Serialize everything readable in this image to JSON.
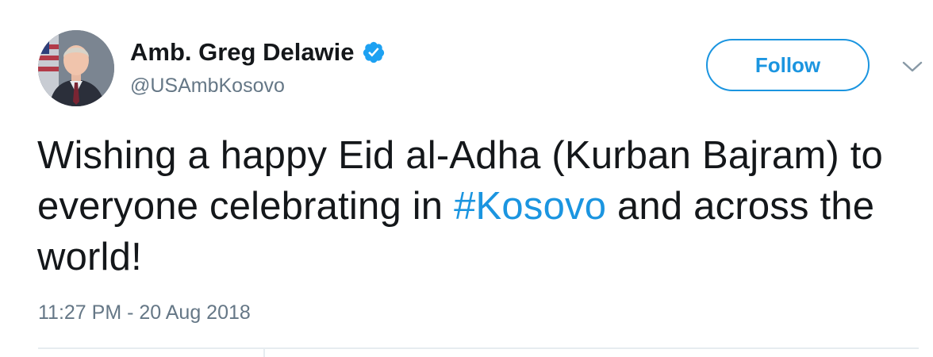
{
  "author": {
    "display_name": "Amb. Greg Delawie",
    "handle": "@USAmbKosovo",
    "verified": true,
    "verified_icon": "verified-badge-icon",
    "avatar_icon": "profile-photo-avatar"
  },
  "actions": {
    "follow_label": "Follow",
    "menu_icon": "chevron-down-icon"
  },
  "tweet": {
    "text_part1": "Wishing a happy Eid al-Adha (Kurban Bajram) to everyone celebrating in ",
    "hashtag": "#Kosovo",
    "text_part2": " and across the world!",
    "timestamp": "11:27 PM - 20 Aug 2018"
  },
  "colors": {
    "text": "#14171a",
    "secondary_text": "#657786",
    "accent": "#1b95e0",
    "divider": "#e6ecf0",
    "background": "#ffffff"
  }
}
